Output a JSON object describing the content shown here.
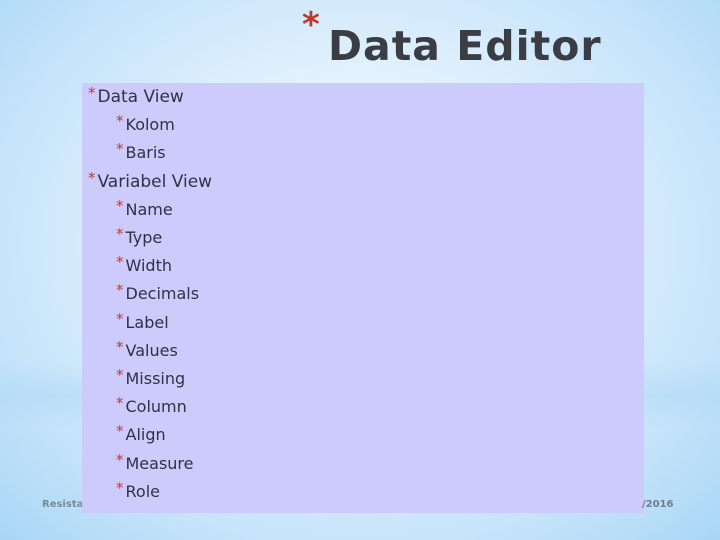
{
  "slide": {
    "title": "Data Editor",
    "bullet_glyph": "*",
    "accent_color": "#c0392b",
    "box_color": "#cccbfc",
    "items": [
      {
        "level": 1,
        "label": "Data View"
      },
      {
        "level": 2,
        "label": "Kolom"
      },
      {
        "level": 2,
        "label": "Baris"
      },
      {
        "level": 1,
        "label": "Variabel View"
      },
      {
        "level": 2,
        "label": "Name"
      },
      {
        "level": 2,
        "label": "Type"
      },
      {
        "level": 2,
        "label": "Width"
      },
      {
        "level": 2,
        "label": "Decimals"
      },
      {
        "level": 2,
        "label": "Label"
      },
      {
        "level": 2,
        "label": "Values"
      },
      {
        "level": 2,
        "label": "Missing"
      },
      {
        "level": 2,
        "label": "Column"
      },
      {
        "level": 2,
        "label": "Align"
      },
      {
        "level": 2,
        "label": "Measure"
      },
      {
        "level": 2,
        "label": "Role"
      }
    ]
  },
  "footer": {
    "left": "Resista",
    "right": "/2016"
  }
}
